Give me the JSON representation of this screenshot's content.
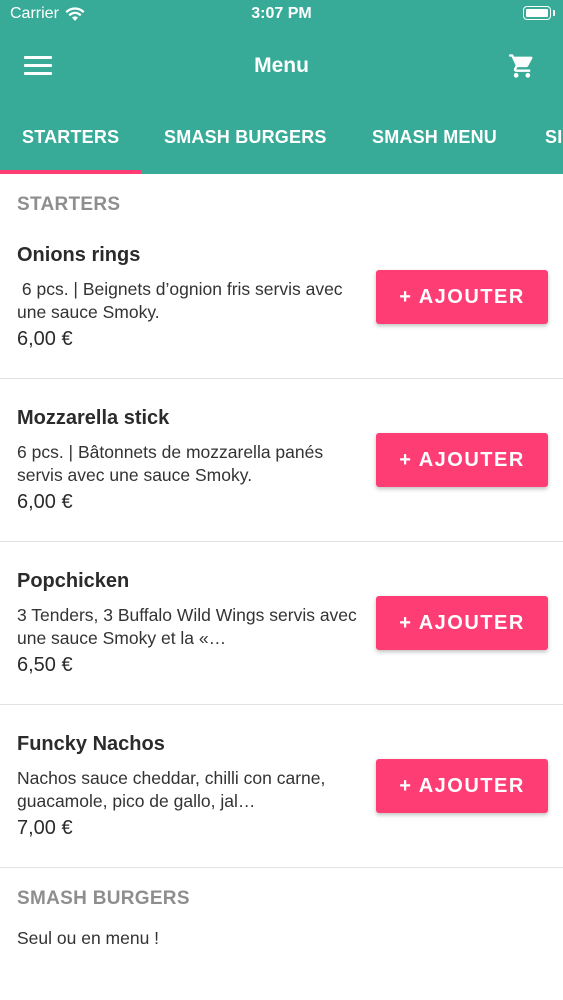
{
  "status_bar": {
    "carrier": "Carrier",
    "time": "3:07 PM"
  },
  "nav": {
    "title": "Menu"
  },
  "tabs": [
    {
      "label": "STARTERS",
      "active": true
    },
    {
      "label": "SMASH BURGERS",
      "active": false
    },
    {
      "label": "SMASH MENU",
      "active": false
    },
    {
      "label": "SI",
      "active": false
    }
  ],
  "sections": [
    {
      "title": "STARTERS",
      "items": [
        {
          "name": "Onions rings",
          "description": " 6 pcs. | Beignets d’ognion fris servis avec une sauce Smoky.",
          "price": "6,00 €",
          "button": "+ AJOUTER"
        },
        {
          "name": "Mozzarella stick",
          "description": "6 pcs. | Bâtonnets de mozzarella panés servis avec une sauce Smoky.",
          "price": "6,00 €",
          "button": "+ AJOUTER"
        },
        {
          "name": "Popchicken",
          "description": "3 Tenders, 3 Buffalo Wild Wings servis avec une sauce Smoky et la «…",
          "price": "6,50 €",
          "button": "+ AJOUTER"
        },
        {
          "name": "Funcky Nachos",
          "description": "Nachos sauce cheddar, chilli con carne, guacamole, pico de gallo, jal…",
          "price": "7,00 €",
          "button": "+ AJOUTER"
        }
      ]
    },
    {
      "title": "SMASH BURGERS",
      "note": "Seul ou en menu !"
    }
  ],
  "colors": {
    "primary": "#37ab98",
    "accent": "#ff3d75",
    "section_header": "#8e8e8e"
  },
  "icons": [
    "wifi-icon",
    "battery-icon",
    "menu-icon",
    "cart-icon"
  ]
}
